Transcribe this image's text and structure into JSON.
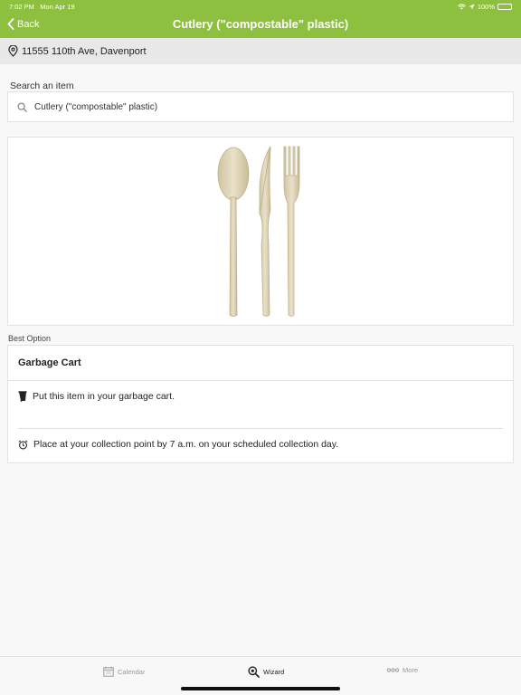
{
  "status": {
    "time": "7:02 PM",
    "date": "Mon Apr 19",
    "battery": "100%",
    "battery_level": 1.0
  },
  "nav": {
    "back_label": "Back",
    "title": "Cutlery (\"compostable\" plastic)"
  },
  "address": {
    "text": "11555 110th Ave, Davenport"
  },
  "search": {
    "label": "Search an item",
    "value": "Cutlery (\"compostable\" plastic)"
  },
  "result": {
    "section_label": "Best Option",
    "title": "Garbage Cart",
    "instructions": [
      {
        "icon": "garbage-cart-icon",
        "text": "Put this item in your garbage cart."
      },
      {
        "icon": "alarm-clock-icon",
        "text": "Place at your collection point by 7 a.m. on your scheduled collection day."
      }
    ]
  },
  "tabs": [
    {
      "label": "Calendar",
      "icon": "calendar-icon",
      "active": false
    },
    {
      "label": "Wizard",
      "icon": "magnifier-icon",
      "active": true
    },
    {
      "label": "More",
      "icon": "more-dots-icon",
      "active": false
    }
  ],
  "colors": {
    "accent": "#8dc03f",
    "address_bg": "#e8e8e8",
    "background": "#f8f8f8"
  }
}
